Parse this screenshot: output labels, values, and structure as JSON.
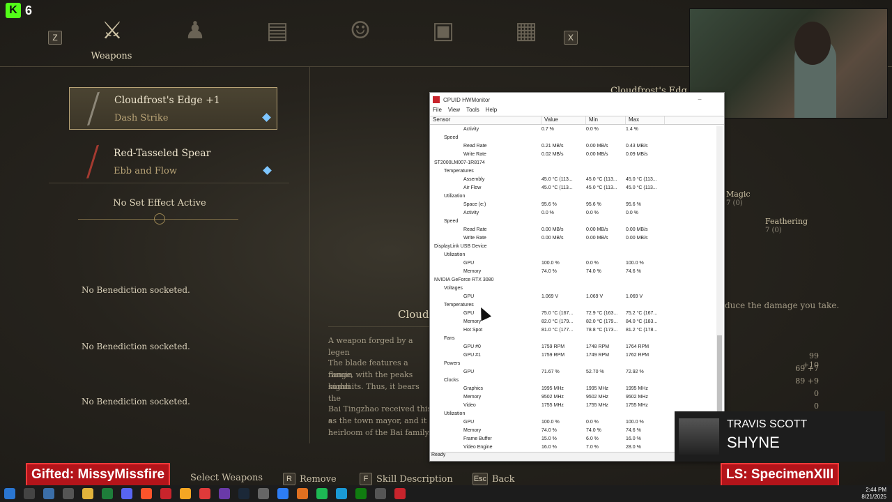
{
  "kick": {
    "count": "6"
  },
  "tabs": {
    "left_key": "Z",
    "right_key": "X",
    "active_label": "Weapons"
  },
  "weapons": [
    {
      "name": "Cloudfrost's Edge +1",
      "skill": "Dash Strike"
    },
    {
      "name": "Red-Tasseled Spear",
      "skill": "Ebb and Flow"
    }
  ],
  "set_effect": "No Set Effect Active",
  "benedictions": [
    "No Benediction socketed.",
    "No Benediction socketed.",
    "No Benediction socketed."
  ],
  "detail": {
    "title_partial": "Cloudf",
    "top_title_partial": "Cloudfrost's Edg",
    "desc": [
      "A weapon forged by a legen",
      "The blade features a flamin",
      "range, with the peaks highli",
      "summits. Thus, it bears the",
      "Bai Tingzhao received this s",
      "as the town mayor, and it h",
      "heirloom of the Bai family."
    ],
    "reduce_text": "duce the damage you take."
  },
  "right_panel": {
    "magic_label": "Magic",
    "magic_val": "7 (0)",
    "feathering_label": "Feathering",
    "feathering_val": "7 (0)",
    "stats": [
      "99 +10",
      "69 +7",
      "89 +9",
      "0",
      "0"
    ]
  },
  "hwmonitor": {
    "title": "CPUID HWMonitor",
    "menu": [
      "File",
      "View",
      "Tools",
      "Help"
    ],
    "columns": [
      "Sensor",
      "Value",
      "Min",
      "Max"
    ],
    "rows": [
      {
        "indent": 4,
        "label": "Activity",
        "value": "0.7 %",
        "min": "0.0 %",
        "max": "1.4 %"
      },
      {
        "indent": 2,
        "label": "Speed",
        "value": "",
        "min": "",
        "max": ""
      },
      {
        "indent": 4,
        "label": "Read Rate",
        "value": "0.21 MB/s",
        "min": "0.00 MB/s",
        "max": "0.43 MB/s"
      },
      {
        "indent": 4,
        "label": "Write Rate",
        "value": "0.02 MB/s",
        "min": "0.00 MB/s",
        "max": "0.09 MB/s"
      },
      {
        "indent": 1,
        "label": "ST2000LM007-1R8174",
        "value": "",
        "min": "",
        "max": ""
      },
      {
        "indent": 2,
        "label": "Temperatures",
        "value": "",
        "min": "",
        "max": ""
      },
      {
        "indent": 4,
        "label": "Assembly",
        "value": "45.0 °C (113...",
        "min": "45.0 °C (113...",
        "max": "45.0 °C (113..."
      },
      {
        "indent": 4,
        "label": "Air Flow",
        "value": "45.0 °C (113...",
        "min": "45.0 °C (113...",
        "max": "45.0 °C (113..."
      },
      {
        "indent": 2,
        "label": "Utilization",
        "value": "",
        "min": "",
        "max": ""
      },
      {
        "indent": 4,
        "label": "Space (e:)",
        "value": "95.6 %",
        "min": "95.6 %",
        "max": "95.6 %"
      },
      {
        "indent": 4,
        "label": "Activity",
        "value": "0.0 %",
        "min": "0.0 %",
        "max": "0.0 %"
      },
      {
        "indent": 2,
        "label": "Speed",
        "value": "",
        "min": "",
        "max": ""
      },
      {
        "indent": 4,
        "label": "Read Rate",
        "value": "0.00 MB/s",
        "min": "0.00 MB/s",
        "max": "0.00 MB/s"
      },
      {
        "indent": 4,
        "label": "Write Rate",
        "value": "0.00 MB/s",
        "min": "0.00 MB/s",
        "max": "0.00 MB/s"
      },
      {
        "indent": 1,
        "label": "DisplayLink USB Device",
        "value": "",
        "min": "",
        "max": ""
      },
      {
        "indent": 2,
        "label": "Utilization",
        "value": "",
        "min": "",
        "max": ""
      },
      {
        "indent": 4,
        "label": "GPU",
        "value": "100.0 %",
        "min": "0.0 %",
        "max": "100.0 %"
      },
      {
        "indent": 4,
        "label": "Memory",
        "value": "74.0 %",
        "min": "74.0 %",
        "max": "74.6 %"
      },
      {
        "indent": 1,
        "label": "NVIDIA GeForce RTX 3080",
        "value": "",
        "min": "",
        "max": ""
      },
      {
        "indent": 2,
        "label": "Voltages",
        "value": "",
        "min": "",
        "max": ""
      },
      {
        "indent": 4,
        "label": "GPU",
        "value": "1.069 V",
        "min": "1.069 V",
        "max": "1.069 V"
      },
      {
        "indent": 2,
        "label": "Temperatures",
        "value": "",
        "min": "",
        "max": ""
      },
      {
        "indent": 4,
        "label": "GPU",
        "value": "75.0 °C (167...",
        "min": "72.9 °C (163...",
        "max": "75.2 °C (167..."
      },
      {
        "indent": 4,
        "label": "Memory",
        "value": "82.0 °C (179...",
        "min": "82.0 °C (179...",
        "max": "84.0 °C (183..."
      },
      {
        "indent": 4,
        "label": "Hot Spot",
        "value": "81.0 °C (177...",
        "min": "78.8 °C (173...",
        "max": "81.2 °C (178..."
      },
      {
        "indent": 2,
        "label": "Fans",
        "value": "",
        "min": "",
        "max": ""
      },
      {
        "indent": 4,
        "label": "GPU #0",
        "value": "1759 RPM",
        "min": "1748 RPM",
        "max": "1764 RPM"
      },
      {
        "indent": 4,
        "label": "GPU #1",
        "value": "1759 RPM",
        "min": "1749 RPM",
        "max": "1762 RPM"
      },
      {
        "indent": 2,
        "label": "Powers",
        "value": "",
        "min": "",
        "max": ""
      },
      {
        "indent": 4,
        "label": "GPU",
        "value": "71.67 %",
        "min": "52.70 %",
        "max": "72.92 %"
      },
      {
        "indent": 2,
        "label": "Clocks",
        "value": "",
        "min": "",
        "max": ""
      },
      {
        "indent": 4,
        "label": "Graphics",
        "value": "1995 MHz",
        "min": "1995 MHz",
        "max": "1995 MHz"
      },
      {
        "indent": 4,
        "label": "Memory",
        "value": "9502 MHz",
        "min": "9502 MHz",
        "max": "9502 MHz"
      },
      {
        "indent": 4,
        "label": "Video",
        "value": "1755 MHz",
        "min": "1755 MHz",
        "max": "1755 MHz"
      },
      {
        "indent": 2,
        "label": "Utilization",
        "value": "",
        "min": "",
        "max": ""
      },
      {
        "indent": 4,
        "label": "GPU",
        "value": "100.0 %",
        "min": "0.0 %",
        "max": "100.0 %"
      },
      {
        "indent": 4,
        "label": "Memory",
        "value": "74.0 %",
        "min": "74.0 %",
        "max": "74.6 %"
      },
      {
        "indent": 4,
        "label": "Frame Buffer",
        "value": "15.0 %",
        "min": "6.0 %",
        "max": "16.0 %"
      },
      {
        "indent": 4,
        "label": "Video Engine",
        "value": "16.0 %",
        "min": "7.0 %",
        "max": "28.0 %"
      }
    ],
    "status": "Ready"
  },
  "overlay": {
    "gifted": "Gifted: MissyMissfire",
    "last_sub": "LS: SpecimenXIII"
  },
  "music": {
    "artist": "TRAVIS SCOTT",
    "song": "SHYNE"
  },
  "hints": [
    {
      "key": "",
      "label": "Select Weapons"
    },
    {
      "key": "R",
      "label": "Remove"
    },
    {
      "key": "F",
      "label": "Skill Description"
    },
    {
      "key": "Esc",
      "label": "Back"
    }
  ],
  "taskbar": {
    "time": "2:44 PM",
    "date": "8/21/2025"
  },
  "colors": {
    "kick": "#53fc18",
    "accent_gold": "#b9a477",
    "overlay_red": "#b3141a",
    "gem_blue": "#7ec6ff"
  }
}
